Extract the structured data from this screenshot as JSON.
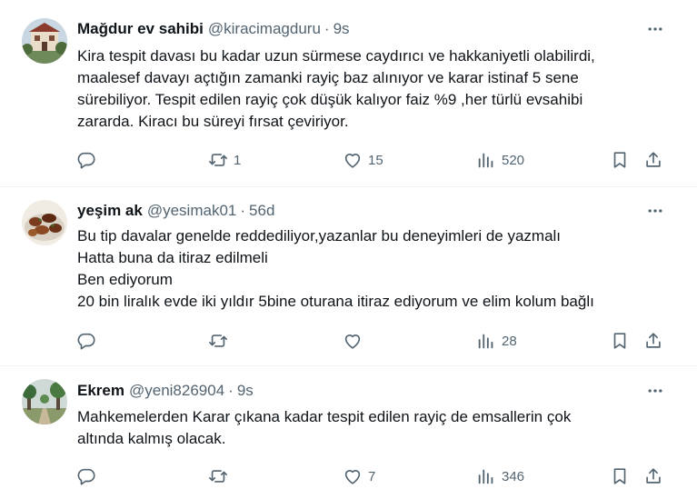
{
  "tweets": [
    {
      "name": "Mağdur ev sahibi",
      "handle": "@kiracimagduru",
      "separator": "·",
      "time": "9s",
      "lines": [
        "Kira tespit davası bu kadar uzun sürmese caydırıcı ve hakkaniyetli olabilirdi,",
        "maalesef davayı açtığın zamanki rayiç baz alınıyor ve karar istinaf 5 sene",
        "sürebiliyor. Tespit edilen rayiç çok düşük kalıyor faiz %9 ,her türlü evsahibi",
        "zararda. Kiracı bu süreyi fırsat çeviriyor."
      ],
      "stats": {
        "replies": "",
        "retweets": "1",
        "likes": "15",
        "views": "520"
      }
    },
    {
      "name": "yeşim ak",
      "handle": "@yesimak01",
      "separator": "·",
      "time": "56d",
      "lines": [
        "Bu tip davalar genelde reddediliyor,yazanlar bu deneyimleri de yazmalı",
        "Hatta buna da itiraz edilmeli",
        "Ben ediyorum",
        "20 bin liralık evde iki yıldır 5bine oturana itiraz ediyorum ve elim kolum bağlı"
      ],
      "stats": {
        "replies": "",
        "retweets": "",
        "likes": "",
        "views": "28"
      }
    },
    {
      "name": "Ekrem",
      "handle": "@yeni826904",
      "separator": "·",
      "time": "9s",
      "lines": [
        "Mahkemelerden Karar çıkana kadar tespit edilen rayiç de emsallerin çok",
        "altında kalmış olacak."
      ],
      "stats": {
        "replies": "",
        "retweets": "",
        "likes": "7",
        "views": "346"
      }
    }
  ],
  "icons": {
    "more": "more-horizontal-icon",
    "reply": "reply-icon",
    "retweet": "retweet-icon",
    "like": "heart-icon",
    "views": "views-chart-icon",
    "bookmark": "bookmark-icon",
    "share": "share-icon"
  },
  "colors": {
    "text": "#0f1419",
    "secondary": "#536471",
    "divider": "#eff3f4"
  }
}
